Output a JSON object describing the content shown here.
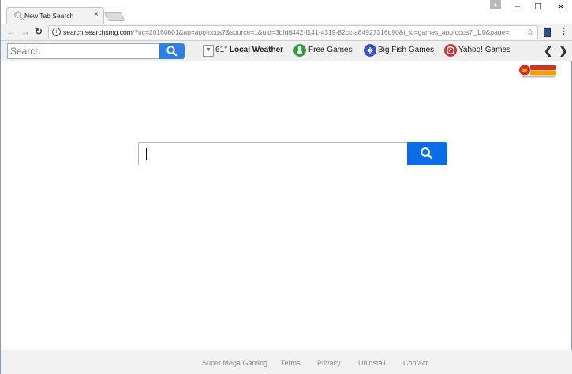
{
  "browser": {
    "tab_title": "New Tab Search",
    "tab_close": "×",
    "url_host": "search.searchsmg.com",
    "url_rest": "/?uc=20160601&ap=appfocus7&source=1&uid=3bfdd442-f141-4319-82cc-a84927316d90&i_id=games_appfocus7_1.0&page=r",
    "window_controls": {
      "minimize": "–",
      "maximize": "☐",
      "close": "✕"
    }
  },
  "toolbar": {
    "search_placeholder": "Search",
    "weather_temp": "61°",
    "weather_label": "Local Weather",
    "free_games": "Free Games",
    "big_fish": "Big Fish Games",
    "yahoo_games": "Yahoo! Games",
    "colors": {
      "search_button": "#2b80ea",
      "free_games_icon": "#2f9a3b",
      "big_fish_icon": "#3b4fc4",
      "yahoo_icon": "#d9272e"
    }
  },
  "main": {
    "search_value": "",
    "search_button_color": "#0a6ce6",
    "logo_icon": "super-mega-gaming-logo"
  },
  "footer": {
    "links": [
      "Super Mega Gaming",
      "Terms",
      "Privacy",
      "Uninstall",
      "Contact"
    ]
  }
}
